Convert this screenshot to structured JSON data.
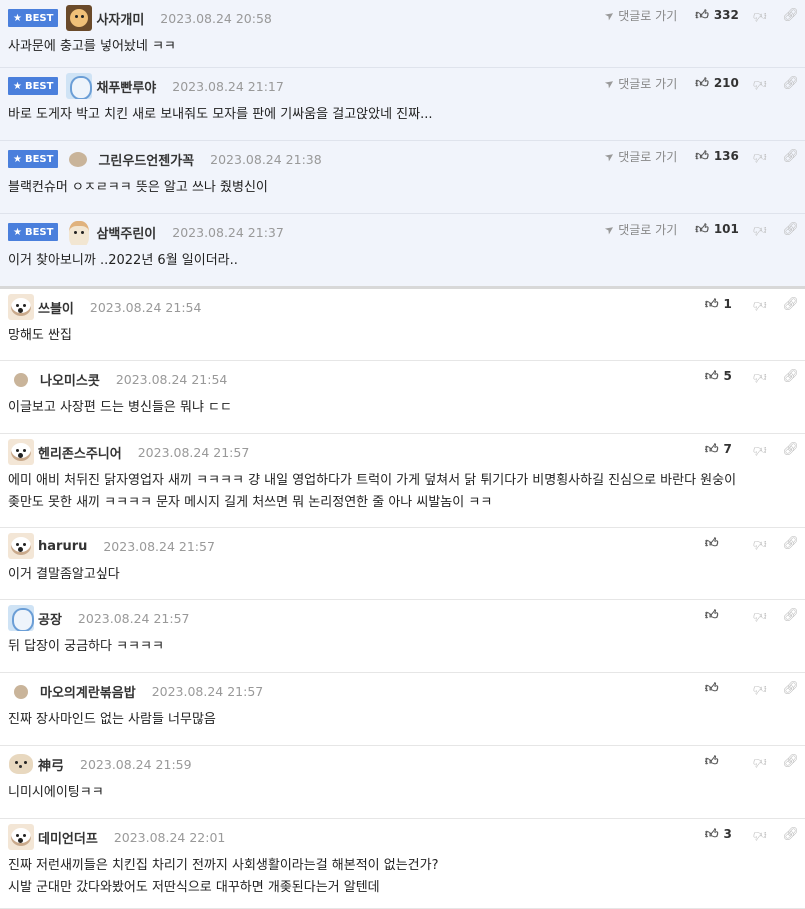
{
  "best_label": "BEST",
  "reply_label": "댓글로 가기",
  "comments": [
    {
      "best": true,
      "avatar": "mascot",
      "nick": "사자개미",
      "date": "2023.08.24 20:58",
      "likes": "332",
      "reply": true,
      "text": "사과문에 충고를 넣어놨네 ㅋㅋ",
      "height": 68
    },
    {
      "best": true,
      "avatar": "blue",
      "nick": "채푸빤루야",
      "date": "2023.08.24 21:17",
      "likes": "210",
      "reply": true,
      "text": "바로 도게자 박고 치킨 새로 보내줘도 모자를 판에 기싸움을 걸고앉았네 진짜...",
      "height": 73
    },
    {
      "best": true,
      "avatar": "blob",
      "nick": "그린우드언젠가꼭",
      "date": "2023.08.24 21:38",
      "likes": "136",
      "reply": true,
      "text": "블랙컨슈머 ㅇㅈㄹㅋㅋ 뜻은 알고 쓰나 줬병신이",
      "height": 73
    },
    {
      "best": true,
      "last": true,
      "avatar": "corgi",
      "nick": "삼백주린이",
      "date": "2023.08.24 21:37",
      "likes": "101",
      "reply": true,
      "text": "이거 찾아보니까 ..2022년 6월 일이더라..",
      "height": 75
    },
    {
      "avatar": "dog",
      "nick": "쓰블이",
      "date": "2023.08.24 21:54",
      "likes": "1",
      "text": "망해도 싼집",
      "height": 72
    },
    {
      "avatar": "blob",
      "nick": "나오미스콧",
      "date": "2023.08.24 21:54",
      "likes": "5",
      "text": "이글보고 사장편 드는 병신들은 뭐냐 ㄷㄷ",
      "height": 73
    },
    {
      "avatar": "dog",
      "nick": "헨리존스주니어",
      "date": "2023.08.24 21:57",
      "likes": "7",
      "text": "에미 애비 처뒤진 닭자영업자 새끼 ㅋㅋㅋㅋ 걍 내일 영업하다가 트럭이 가게 덮쳐서 닭 튀기다가 비명횡사하길 진심으로 바란다 원숭이\n좆만도 못한 새끼 ㅋㅋㅋㅋ 문자 메시지 길게 처쓰면 뭐 논리정연한 줄 아나 씨발놈이 ㅋㅋ",
      "height": 94
    },
    {
      "avatar": "dog",
      "nick": "haruru",
      "date": "2023.08.24 21:57",
      "likes": "",
      "text": "이거 결말좀알고싶다",
      "height": 72
    },
    {
      "avatar": "blue",
      "nick": "공장",
      "date": "2023.08.24 21:57",
      "likes": "",
      "text": "뒤 답장이 궁금하다 ㅋㅋㅋㅋ",
      "height": 73
    },
    {
      "avatar": "blob",
      "nick": "마오의계란볶음밥",
      "date": "2023.08.24 21:57",
      "likes": "",
      "text": "진짜 장사마인드 없는 사람들 너무많음",
      "height": 73
    },
    {
      "avatar": "bear",
      "nick": "神弓",
      "date": "2023.08.24 21:59",
      "likes": "",
      "text": "니미시에이팅ㅋㅋ",
      "height": 73
    },
    {
      "avatar": "dog",
      "nick": "데미언더프",
      "date": "2023.08.24 22:01",
      "likes": "3",
      "text": "진짜 저런새끼들은 치킨집 차리기 전까지 사회생활이라는걸 해본적이 없는건가?\n시발 군대만 갔다와봤어도 저딴식으로 대꾸하면 개좆된다는거 알텐데",
      "height": 90
    }
  ]
}
